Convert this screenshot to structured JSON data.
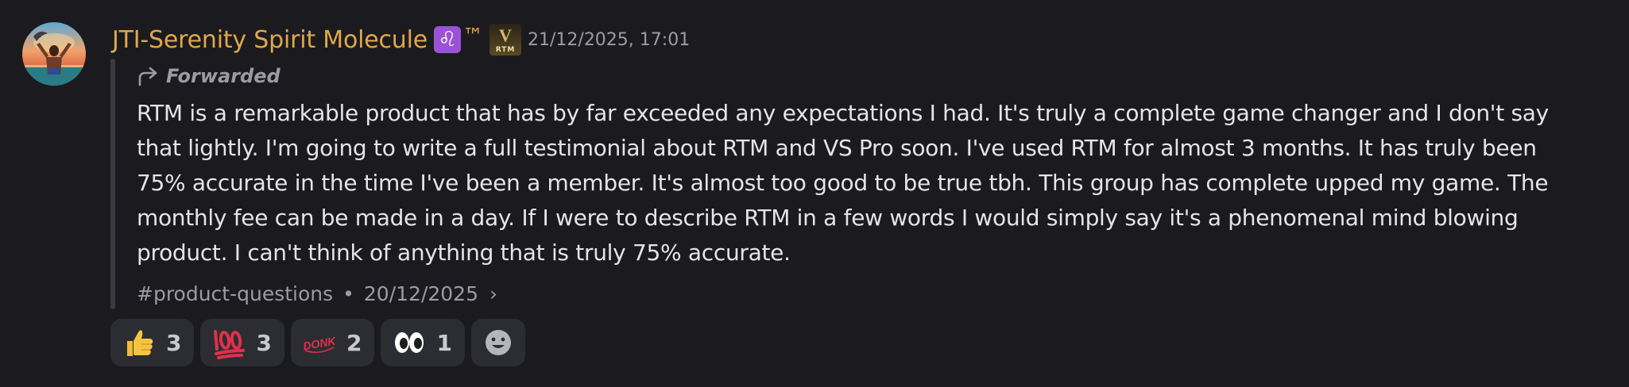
{
  "message": {
    "author": "JTI-Serenity Spirit Molecule",
    "role_badge_glyph": "♌",
    "trademark": "™",
    "server_tag": {
      "letter": "V",
      "text": "RTM"
    },
    "timestamp": "21/12/2025, 17:01",
    "forwarded_label": "Forwarded",
    "content": "RTM is a remarkable product that has by far exceeded any expectations I had.  It's truly a complete game changer and I don't say that lightly.  I'm going to write a full testimonial about RTM and VS Pro soon.  I've used RTM for almost 3 months.  It has truly been 75% accurate in the time I've been a member.  It's almost too good to be true tbh.  This group has complete upped my game.  The monthly fee can be made in a day.  If I were to describe RTM in a few words I would simply say it's a  phenomenal mind blowing product.  I can't think of anything that is truly 75% accurate.",
    "source_channel": "#product-questions",
    "source_separator": "•",
    "source_date": "20/12/2025",
    "source_chevron": "›"
  },
  "reactions": [
    {
      "icon": "thumbs-up-icon",
      "count": "3"
    },
    {
      "icon": "hundred-points-icon",
      "count": "3"
    },
    {
      "icon": "donk-sticker-icon",
      "sticker_text": "DONK",
      "count": "2"
    },
    {
      "icon": "eyes-icon",
      "count": "1"
    }
  ],
  "colors": {
    "background": "#1b1b1f",
    "username": "#e0a74a",
    "muted": "#9b9ca3",
    "reaction_bg": "#2c2d33"
  }
}
